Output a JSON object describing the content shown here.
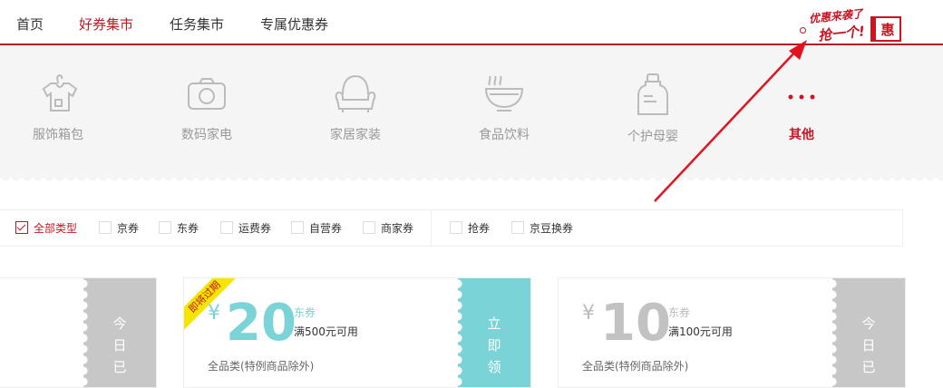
{
  "nav": {
    "items": [
      {
        "label": "首页"
      },
      {
        "label": "好券集市"
      },
      {
        "label": "任务集市"
      },
      {
        "label": "专属优惠券"
      }
    ],
    "logo": {
      "line1": "优惠来袭了",
      "line2": "抢一个!",
      "badge": "惠"
    }
  },
  "categories": [
    {
      "label": "服饰箱包",
      "icon": "shirt-icon"
    },
    {
      "label": "数码家电",
      "icon": "camera-icon"
    },
    {
      "label": "家居家装",
      "icon": "sofa-icon"
    },
    {
      "label": "食品饮料",
      "icon": "bowl-icon"
    },
    {
      "label": "个护母婴",
      "icon": "bottle-icon"
    },
    {
      "label": "其他",
      "icon": "more-dots-icon"
    }
  ],
  "filters": [
    {
      "label": "全部类型",
      "checked": true
    },
    {
      "label": "京券"
    },
    {
      "label": "东券"
    },
    {
      "label": "运费券"
    },
    {
      "label": "自营券"
    },
    {
      "label": "商家券"
    },
    {
      "label": "抢券"
    },
    {
      "label": "京豆换券"
    }
  ],
  "coupons": [
    {
      "stub_text": "今日已"
    },
    {
      "ribbon": "即将过期",
      "currency": "¥",
      "amount": "20",
      "type": "东券",
      "condition": "满500元可用",
      "scope": "全品类(特例商品除外)",
      "stub_text": "立即领"
    },
    {
      "currency": "¥",
      "amount": "10",
      "type": "东券",
      "condition": "满100元可用",
      "scope": "全品类(特例商品除外)",
      "stub_text": "今日已"
    }
  ],
  "colors": {
    "brand": "#b81c22",
    "teal": "#7ad3d6",
    "gray": "#c7c7c7"
  }
}
